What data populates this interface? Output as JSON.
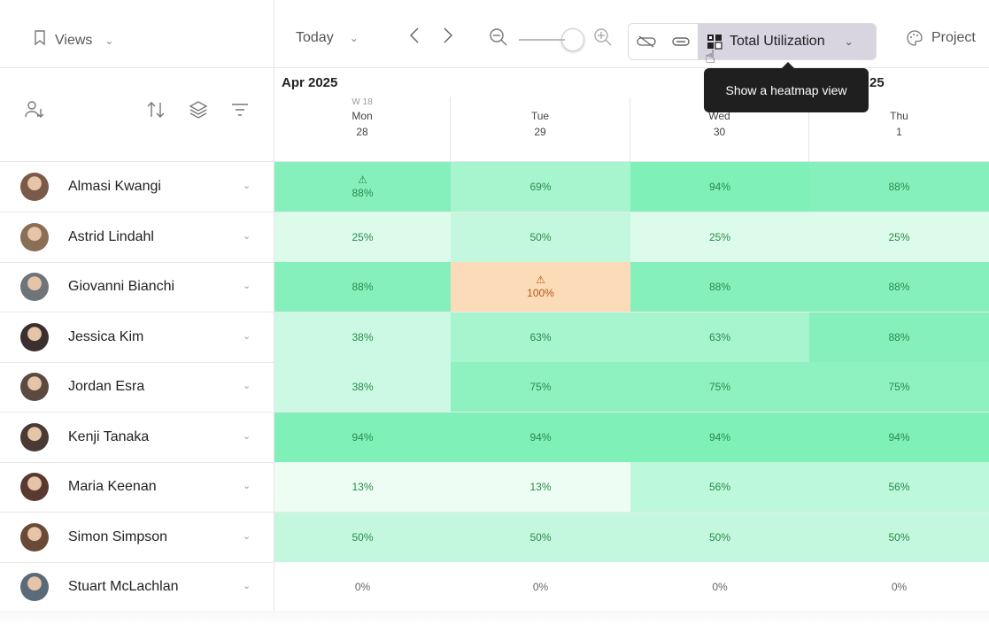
{
  "toolbar": {
    "views_label": "Views",
    "today_label": "Today",
    "view_mode_label": "Total Utilization",
    "project_label": "Project"
  },
  "tooltip": "Show a heatmap view",
  "header": {
    "month_left": "Apr 2025",
    "month_right": "25",
    "week_label": "W 18",
    "days": [
      {
        "name": "Mon",
        "num": "28"
      },
      {
        "name": "Tue",
        "num": "29"
      },
      {
        "name": "Wed",
        "num": "30"
      },
      {
        "name": "Thu",
        "num": "1"
      }
    ]
  },
  "colors": {
    "heat_100": "#7ef0b8",
    "heat_90": "#7ef0b8",
    "heat_85": "#86f0bc",
    "heat_75": "#8ef2c0",
    "heat_70": "#a6f5cf",
    "heat_55": "#bcf8da",
    "heat_45": "#c4f8de",
    "heat_35": "#ccf9e3",
    "heat_20": "#dcfbeb",
    "heat_10": "#eefdf4",
    "over": "#fcdcb8"
  },
  "people": [
    {
      "name": "Almasi Kwangi",
      "avatar_color": "#7a5a48",
      "cells": [
        {
          "value": "88%",
          "level": 88,
          "warning": true
        },
        {
          "value": "69%",
          "level": 69
        },
        {
          "value": "94%",
          "level": 94
        },
        {
          "value": "88%",
          "level": 88
        }
      ]
    },
    {
      "name": "Astrid Lindahl",
      "avatar_color": "#8a6e56",
      "cells": [
        {
          "value": "25%",
          "level": 25
        },
        {
          "value": "50%",
          "level": 50
        },
        {
          "value": "25%",
          "level": 25
        },
        {
          "value": "25%",
          "level": 25
        }
      ]
    },
    {
      "name": "Giovanni Bianchi",
      "avatar_color": "#6e7478",
      "cells": [
        {
          "value": "88%",
          "level": 88
        },
        {
          "value": "100%",
          "level": 100,
          "warning": true,
          "over": true
        },
        {
          "value": "88%",
          "level": 88
        },
        {
          "value": "88%",
          "level": 88
        }
      ]
    },
    {
      "name": "Jessica Kim",
      "avatar_color": "#3a3030",
      "cells": [
        {
          "value": "38%",
          "level": 38
        },
        {
          "value": "63%",
          "level": 63
        },
        {
          "value": "63%",
          "level": 63
        },
        {
          "value": "88%",
          "level": 88
        }
      ]
    },
    {
      "name": "Jordan Esra",
      "avatar_color": "#5a4a40",
      "cells": [
        {
          "value": "38%",
          "level": 38
        },
        {
          "value": "75%",
          "level": 75
        },
        {
          "value": "75%",
          "level": 75
        },
        {
          "value": "75%",
          "level": 75
        }
      ]
    },
    {
      "name": "Kenji Tanaka",
      "avatar_color": "#4a3a34",
      "cells": [
        {
          "value": "94%",
          "level": 94
        },
        {
          "value": "94%",
          "level": 94
        },
        {
          "value": "94%",
          "level": 94
        },
        {
          "value": "94%",
          "level": 94
        }
      ]
    },
    {
      "name": "Maria Keenan",
      "avatar_color": "#5a3a30",
      "cells": [
        {
          "value": "13%",
          "level": 13
        },
        {
          "value": "13%",
          "level": 13
        },
        {
          "value": "56%",
          "level": 56
        },
        {
          "value": "56%",
          "level": 56
        }
      ]
    },
    {
      "name": "Simon Simpson",
      "avatar_color": "#6a4a36",
      "cells": [
        {
          "value": "50%",
          "level": 50
        },
        {
          "value": "50%",
          "level": 50
        },
        {
          "value": "50%",
          "level": 50
        },
        {
          "value": "50%",
          "level": 50
        }
      ]
    },
    {
      "name": "Stuart McLachlan",
      "avatar_color": "#5a6a78",
      "cells": [
        {
          "value": "0%",
          "level": 0
        },
        {
          "value": "0%",
          "level": 0
        },
        {
          "value": "0%",
          "level": 0
        },
        {
          "value": "0%",
          "level": 0
        }
      ]
    }
  ]
}
